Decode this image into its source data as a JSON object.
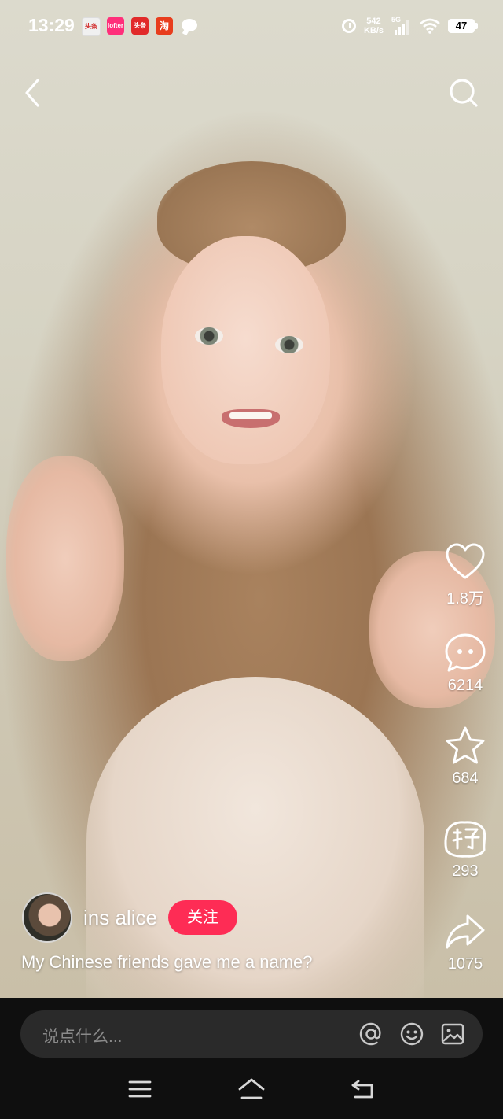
{
  "status_bar": {
    "time": "13:29",
    "notifications": [
      "头条",
      "lofter",
      "头条",
      "淘"
    ],
    "net_speed_value": "542",
    "net_speed_unit": "KB/s",
    "network": "5G",
    "battery": "47"
  },
  "top_nav": {
    "back_icon": "chevron-left-icon",
    "search_icon": "search-icon"
  },
  "actions": {
    "like_count": "1.8万",
    "comment_count": "6214",
    "favorite_count": "684",
    "gift_count": "293",
    "share_count": "1075"
  },
  "author": {
    "name": "ins alice",
    "follow_label": "关注"
  },
  "caption": "My Chinese friends gave me a name?",
  "comment_bar": {
    "placeholder": "说点什么..."
  },
  "colors": {
    "accent": "#fe2c55",
    "comment_bar_bg": "#2a2a2a",
    "bottom_bg": "#0f0f0f"
  }
}
